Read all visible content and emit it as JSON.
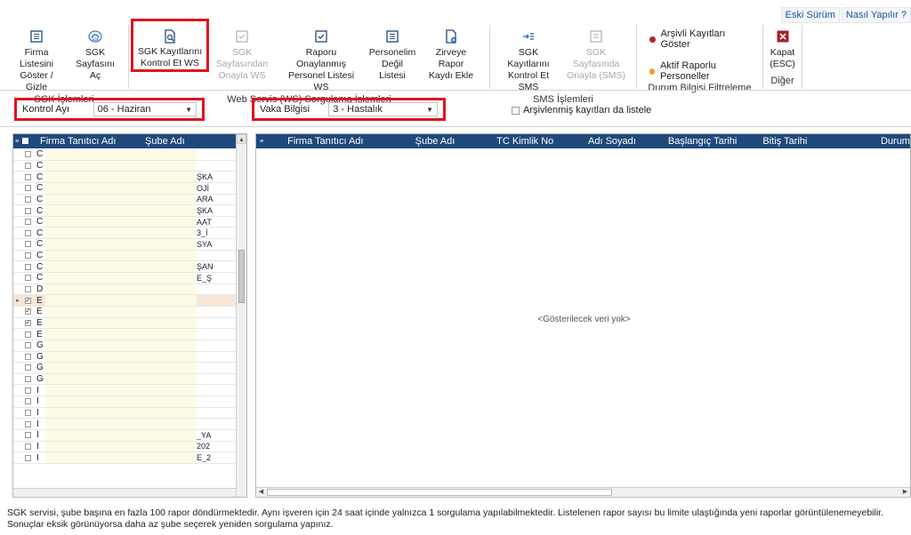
{
  "toplinks": {
    "old_version": "Eski Sürüm",
    "how_to": "Nasıl Yapılır ?"
  },
  "ribbon": {
    "groups": [
      {
        "label": "SGK İşlemleri",
        "buttons": [
          {
            "l1": "Firma Listesini",
            "l2": "Göster / Gizle"
          },
          {
            "l1": "SGK",
            "l2": "Sayfasını Aç"
          }
        ]
      },
      {
        "label": "Web Servis (WS) Sorgulama İşlemleri",
        "buttons": [
          {
            "l1": "SGK Kayıtlarını",
            "l2": "Kontrol Et WS"
          },
          {
            "l1": "SGK Sayfasından",
            "l2": "Onayla WS"
          },
          {
            "l1": "Raporu Onaylanmış",
            "l2": "Personel Listesi WS"
          },
          {
            "l1": "Personelim",
            "l2": "Değil Listesi"
          },
          {
            "l1": "Zirveye Rapor",
            "l2": "Kaydı Ekle"
          }
        ]
      },
      {
        "label": "SMS İşlemleri",
        "buttons": [
          {
            "l1": "SGK Kayıtlarını",
            "l2": "Kontrol Et SMS"
          },
          {
            "l1": "SGK Sayfasında",
            "l2": "Onayla (SMS)"
          }
        ]
      },
      {
        "label": "Durum Bilgisi Filtreleme",
        "items": [
          {
            "label": "Arşivli Kayıtları Göster",
            "color": "#b2242a"
          },
          {
            "label": "Aktif Raporlu Personeller",
            "color": "#f0a020"
          }
        ]
      },
      {
        "label": "Diğer",
        "buttons": [
          {
            "l1": "Kapat",
            "l2": "(ESC)"
          }
        ]
      }
    ]
  },
  "filters": {
    "control_month_label": "Kontrol Ayı",
    "control_month_value": "06 - Haziran",
    "case_info_label": "Vaka Bilgisi",
    "case_info_value": "3 - Hastalık",
    "archive_label": "Arşivlenmiş kayıtları da listele"
  },
  "left_grid": {
    "headers": [
      "Firma Tanıtıcı Adı",
      "Şube Adı"
    ],
    "rows": [
      {
        "c1": "C",
        "c2": "",
        "checked": false,
        "sel": false
      },
      {
        "c1": "C",
        "c2": "",
        "checked": false,
        "sel": false
      },
      {
        "c1": "C",
        "c2": "ŞKA",
        "checked": false,
        "sel": false
      },
      {
        "c1": "C",
        "c2": "OJİ",
        "checked": false,
        "sel": false
      },
      {
        "c1": "C",
        "c2": "ARA",
        "checked": false,
        "sel": false
      },
      {
        "c1": "C",
        "c2": "ŞKA",
        "checked": false,
        "sel": false
      },
      {
        "c1": "C",
        "c2": "AAT",
        "checked": false,
        "sel": false
      },
      {
        "c1": "C",
        "c2": "3_İ",
        "checked": false,
        "sel": false
      },
      {
        "c1": "C",
        "c2": "SYA",
        "checked": false,
        "sel": false
      },
      {
        "c1": "C",
        "c2": "",
        "checked": false,
        "sel": false
      },
      {
        "c1": "C",
        "c2": "ŞAN",
        "checked": false,
        "sel": false
      },
      {
        "c1": "C",
        "c2": "E_Ş",
        "checked": false,
        "sel": false
      },
      {
        "c1": "D",
        "c2": "",
        "checked": false,
        "sel": false
      },
      {
        "c1": "E",
        "c2": "",
        "checked": true,
        "sel": true
      },
      {
        "c1": "E",
        "c2": "",
        "checked": true,
        "sel": false
      },
      {
        "c1": "E",
        "c2": "",
        "checked": true,
        "sel": false
      },
      {
        "c1": "E",
        "c2": "",
        "checked": false,
        "sel": false
      },
      {
        "c1": "G",
        "c2": "",
        "checked": false,
        "sel": false
      },
      {
        "c1": "G",
        "c2": "",
        "checked": false,
        "sel": false
      },
      {
        "c1": "G",
        "c2": "",
        "checked": false,
        "sel": false
      },
      {
        "c1": "G",
        "c2": "",
        "checked": false,
        "sel": false
      },
      {
        "c1": "İ",
        "c2": "",
        "checked": false,
        "sel": false
      },
      {
        "c1": "İ",
        "c2": "",
        "checked": false,
        "sel": false
      },
      {
        "c1": "İ",
        "c2": "",
        "checked": false,
        "sel": false
      },
      {
        "c1": "İ",
        "c2": "",
        "checked": false,
        "sel": false
      },
      {
        "c1": "İ",
        "c2": "_YA",
        "checked": false,
        "sel": false
      },
      {
        "c1": "İ",
        "c2": "202",
        "checked": false,
        "sel": false
      },
      {
        "c1": "İ",
        "c2": "E_2",
        "checked": false,
        "sel": false
      }
    ]
  },
  "right_grid": {
    "headers": [
      "Firma Tanıtıcı Adı",
      "Şube Adı",
      "TC Kimlik No",
      "Adı Soyadı",
      "Başlangıç Tarihi",
      "Bitiş Tarihi",
      "Durum"
    ],
    "empty": "<Gösterilecek veri yok>"
  },
  "footer": {
    "note": "SGK servisi, şube başına en fazla 100 rapor döndürmektedir. Aynı işveren için 24 saat içinde yalnızca 1 sorgulama yapılabilmektedir. Listelenen rapor sayısı bu limite ulaştığında yeni raporlar görüntülenemeyebilir. Sonuçlar eksik görünüyorsa daha az şube seçerek yeniden sorgulama yapınız."
  }
}
